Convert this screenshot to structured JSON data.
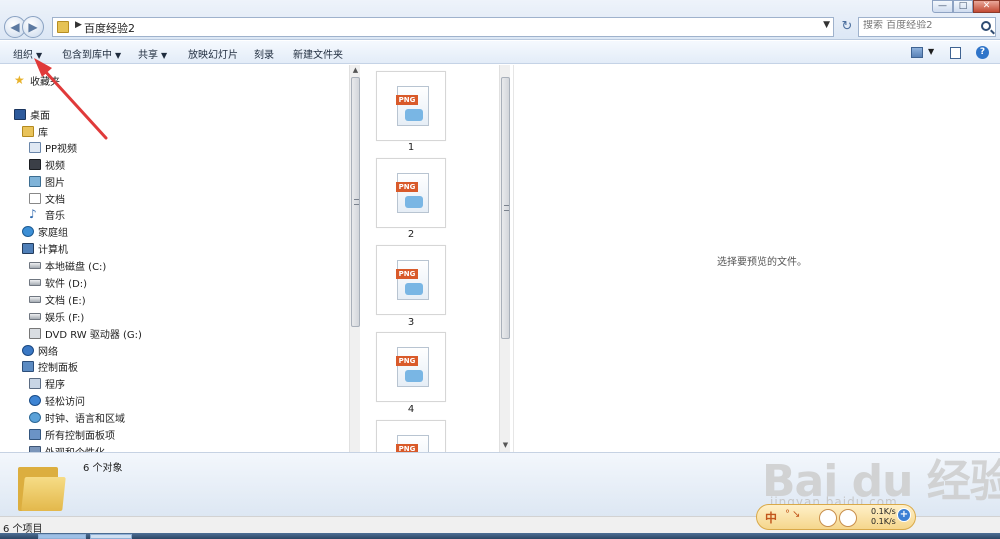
{
  "window": {
    "minimize": "—",
    "maximize": "□",
    "close": "✕"
  },
  "nav": {
    "back": "◀",
    "forward": "▶",
    "path": "百度经验2",
    "path_separator": "▶",
    "dropdown": "▼",
    "refresh": "↻"
  },
  "search": {
    "placeholder": "搜索 百度经验2"
  },
  "toolbar": {
    "organize": "组织",
    "include_in_library": "包含到库中",
    "share": "共享",
    "slideshow": "放映幻灯片",
    "burn": "刻录",
    "new_folder": "新建文件夹",
    "caret": "▼",
    "help": "?"
  },
  "sidebar": {
    "favorites": "收藏夹",
    "desktop": "桌面",
    "libraries": "库",
    "pp_video": "PP视频",
    "videos": "视频",
    "pictures": "图片",
    "documents": "文档",
    "music": "音乐",
    "homegroup": "家庭组",
    "computer": "计算机",
    "drive_c": "本地磁盘 (C:)",
    "drive_d": "软件 (D:)",
    "drive_e": "文档 (E:)",
    "drive_f": "娱乐 (F:)",
    "drive_g": "DVD RW 驱动器 (G:)",
    "network": "网络",
    "control_panel": "控制面板",
    "programs": "程序",
    "ease_of_access": "轻松访问",
    "clock_language": "时钟、语言和区域",
    "all_cp_items": "所有控制面板项",
    "appearance": "外观和个性化"
  },
  "files": [
    {
      "name": "1",
      "badge": "PNG"
    },
    {
      "name": "2",
      "badge": "PNG"
    },
    {
      "name": "3",
      "badge": "PNG"
    },
    {
      "name": "4",
      "badge": "PNG"
    },
    {
      "name": "",
      "badge": "PNG"
    }
  ],
  "preview": {
    "message": "选择要预览的文件。"
  },
  "details": {
    "count": "6 个对象"
  },
  "status": {
    "items": "6 个项目"
  },
  "ime": {
    "zh": "中",
    "dots": "°↘",
    "upload": "0.1K/s",
    "download": "0.1K/s",
    "badge": "+"
  },
  "watermark": {
    "brand": "Bai du 经验",
    "url": "jingyan.baidu.com"
  },
  "colors": {
    "annotation_arrow": "#e03a3a",
    "png_badge": "#d95a2a",
    "folder": "#e3b84b"
  }
}
